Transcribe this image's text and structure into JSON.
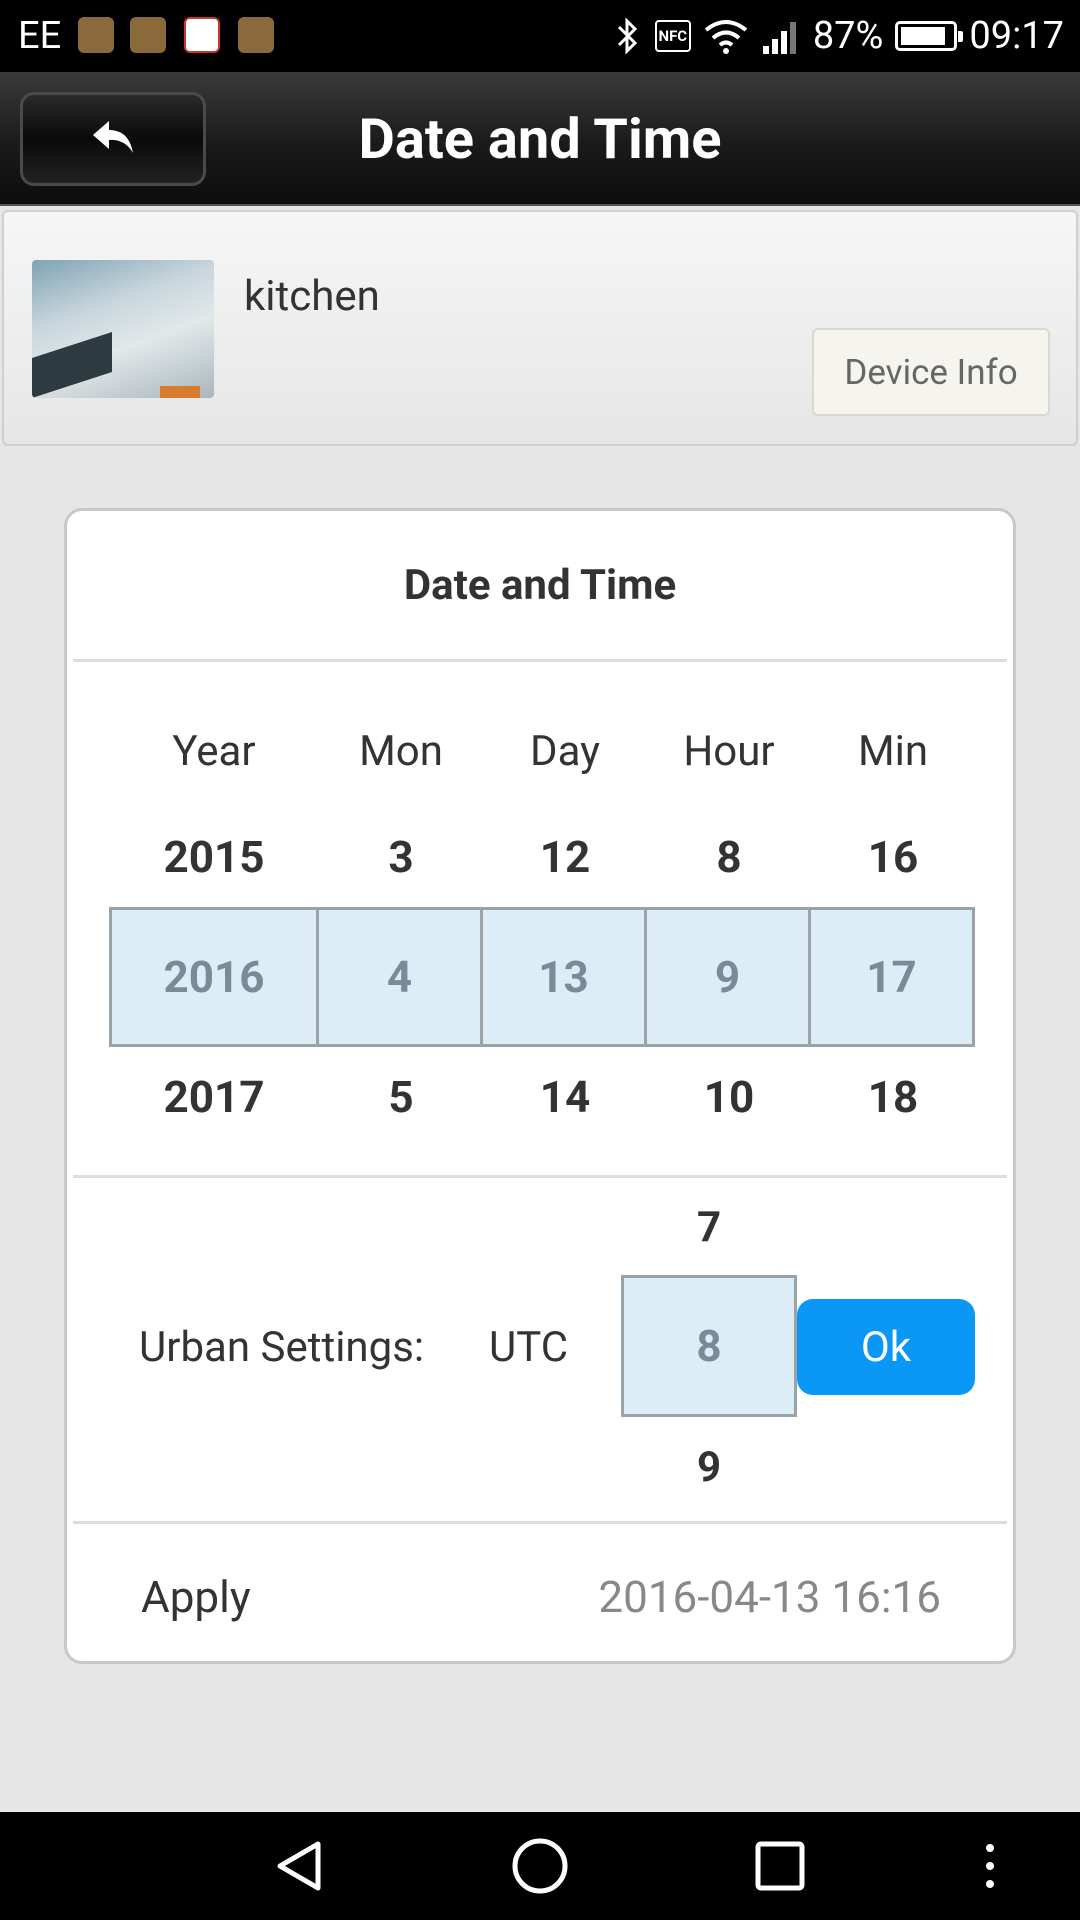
{
  "status_bar": {
    "carrier": "EE",
    "battery": "87%",
    "battery_level": 0.87,
    "time": "09:17",
    "nfc": "NFC",
    "icons": [
      "health-app-icon",
      "gallery-icon",
      "gmail-icon",
      "security-app-icon",
      "bluetooth-icon",
      "nfc-icon",
      "wifi-icon",
      "signal-icon",
      "battery-icon"
    ]
  },
  "header": {
    "title": "Date and Time",
    "back_icon": "back-arrow-icon"
  },
  "device": {
    "name": "kitchen",
    "info_button": "Device Info"
  },
  "dialog": {
    "title": "Date and Time",
    "columns": [
      {
        "label": "Year",
        "prev": "2015",
        "selected": "2016",
        "next": "2017"
      },
      {
        "label": "Mon",
        "prev": "3",
        "selected": "4",
        "next": "5"
      },
      {
        "label": "Day",
        "prev": "12",
        "selected": "13",
        "next": "14"
      },
      {
        "label": "Hour",
        "prev": "8",
        "selected": "9",
        "next": "10"
      },
      {
        "label": "Min",
        "prev": "16",
        "selected": "17",
        "next": "18"
      }
    ],
    "timezone": {
      "label": "Urban Settings:",
      "prefix": "UTC",
      "prev": "7",
      "selected": "8",
      "next": "9",
      "ok_button": "Ok"
    },
    "apply": {
      "label": "Apply",
      "datetime": "2016-04-13 16:16"
    }
  },
  "colors": {
    "accent": "#0a97f5",
    "selection_bg": "#dcedf8",
    "header_bg": "#1a1a1a"
  }
}
